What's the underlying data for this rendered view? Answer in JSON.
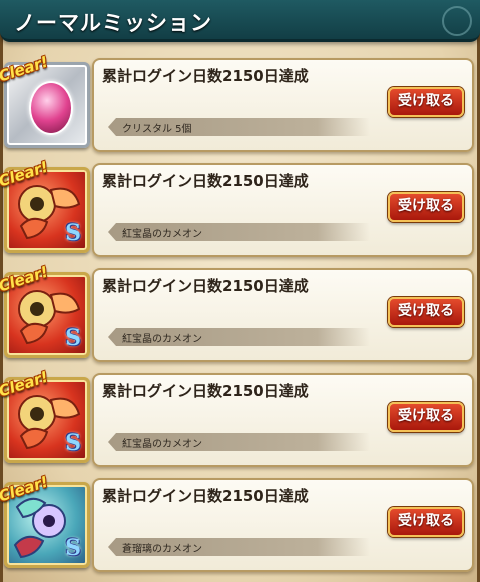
{
  "header": {
    "title": "ノーマルミッション"
  },
  "badge_text": "Clear!",
  "missions": [
    {
      "title": "累計ログイン日数2150日達成",
      "reward": "クリスタル 5個",
      "button_label": "受け取る",
      "icon": "crystal-gem-icon",
      "status": "Clear!"
    },
    {
      "title": "累計ログイン日数2150日達成",
      "reward": "紅宝晶のカメオン",
      "button_label": "受け取る",
      "icon": "ruby-chameleon-icon",
      "status": "Clear!"
    },
    {
      "title": "累計ログイン日数2150日達成",
      "reward": "紅宝晶のカメオン",
      "button_label": "受け取る",
      "icon": "ruby-chameleon-icon",
      "status": "Clear!"
    },
    {
      "title": "累計ログイン日数2150日達成",
      "reward": "紅宝晶のカメオン",
      "button_label": "受け取る",
      "icon": "ruby-chameleon-icon",
      "status": "Clear!"
    },
    {
      "title": "累計ログイン日数2150日達成",
      "reward": "蒼瑠璃のカメオン",
      "button_label": "受け取る",
      "icon": "lapis-chameleon-icon",
      "status": "Clear!"
    }
  ],
  "colors": {
    "header_bg": "#1a4f57",
    "button_bg": "#c52a17",
    "button_border": "#f4c257",
    "clear_text": "#ffe24a"
  }
}
